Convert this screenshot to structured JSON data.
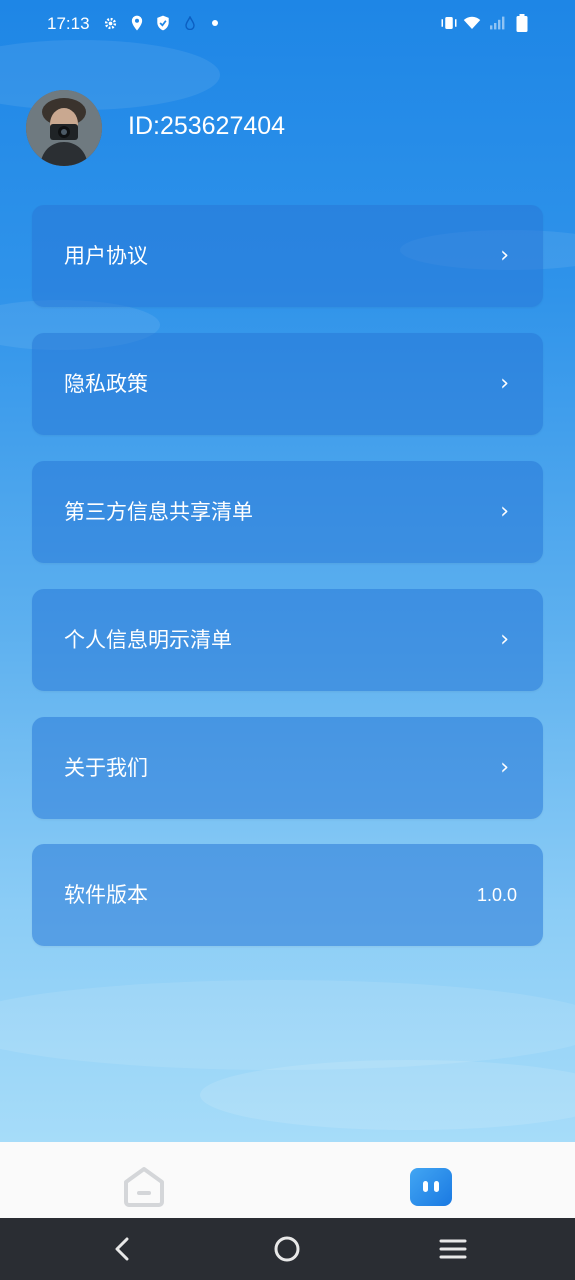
{
  "status_bar": {
    "time": "17:13",
    "icons_left": [
      "gear-icon",
      "location-icon",
      "shield-icon",
      "drop-icon",
      "dot-icon"
    ],
    "icons_right": [
      "vibrate-icon",
      "wifi-icon",
      "signal-icon",
      "battery-icon"
    ]
  },
  "profile": {
    "id_text": "ID:253627404"
  },
  "menu": {
    "items": [
      {
        "label": "用户协议",
        "trailing": "›"
      },
      {
        "label": "隐私政策",
        "trailing": "›"
      },
      {
        "label": "第三方信息共享清单",
        "trailing": "›"
      },
      {
        "label": "个人信息明示清单",
        "trailing": "›"
      },
      {
        "label": "关于我们",
        "trailing": "›"
      },
      {
        "label": "软件版本",
        "value": "1.0.0"
      }
    ]
  },
  "tab_bar": {
    "tabs": [
      {
        "icon": "home-icon",
        "active": false
      },
      {
        "icon": "profile-icon",
        "active": true
      }
    ]
  },
  "nav_bar": {
    "buttons": [
      "back-icon",
      "home-circle-icon",
      "menu-icon"
    ]
  },
  "colors": {
    "bg_top": "#1e86e6",
    "bg_bottom": "#a6dcf9",
    "card": "#2878d7",
    "tab_active": "#1a79e2",
    "nav_bar": "#2a2d33"
  }
}
